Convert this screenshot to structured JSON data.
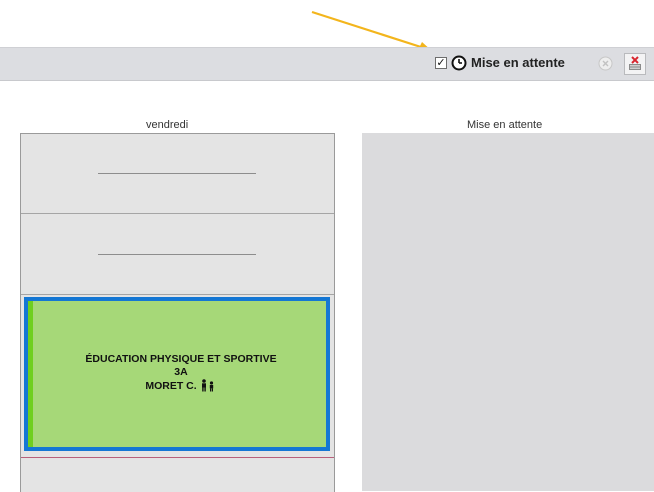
{
  "annotation": {
    "arrow_color": "#f3b51c"
  },
  "toolbar": {
    "checkbox_mark": "✓",
    "checkbox_checked": true,
    "clock_icon": "clock-icon",
    "label": "Mise en attente",
    "clear_icon": "circle-x-icon",
    "exit_icon": "exit-icon"
  },
  "columns": {
    "day_header": "vendredi",
    "waiting_header": "Mise en attente"
  },
  "course": {
    "subject": "ÉDUCATION PHYSIQUE ET SPORTIVE",
    "group": "3A",
    "teacher": "MORET C.",
    "people_icon": "people-icon",
    "colors": {
      "fill": "#a6d878",
      "border": "#1477d4",
      "stripe": "#6fcf1f"
    }
  }
}
